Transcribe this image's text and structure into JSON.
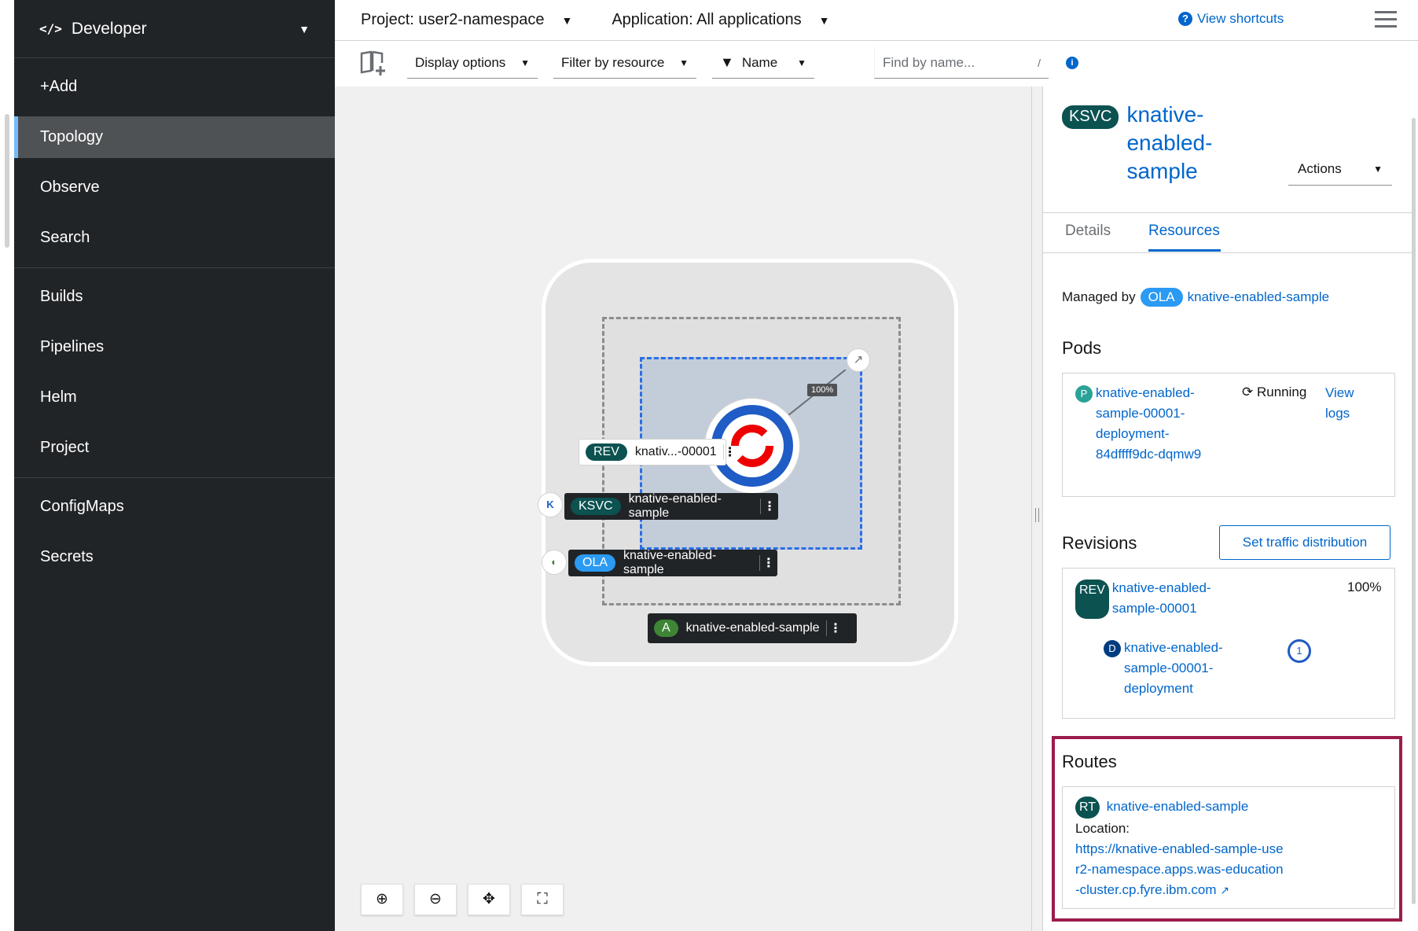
{
  "perspective": {
    "icon": "code-icon",
    "label": "Developer"
  },
  "nav": {
    "groups": [
      [
        {
          "label": "+Add"
        },
        {
          "label": "Topology",
          "active": true
        },
        {
          "label": "Observe"
        },
        {
          "label": "Search"
        }
      ],
      [
        {
          "label": "Builds"
        },
        {
          "label": "Pipelines"
        },
        {
          "label": "Helm"
        },
        {
          "label": "Project"
        }
      ],
      [
        {
          "label": "ConfigMaps"
        },
        {
          "label": "Secrets"
        }
      ]
    ]
  },
  "topbar": {
    "project": "Project: user2-namespace",
    "application": "Application: All applications",
    "shortcuts": "View shortcuts"
  },
  "toolbar": {
    "display_options": "Display options",
    "filter_by_resource": "Filter by resource",
    "filter_field": "Name",
    "find_placeholder": "Find by name...",
    "find_shortcut": "/"
  },
  "topology": {
    "traffic_percent": "100%",
    "revision": {
      "badge": "REV",
      "label": "knativ...-00001"
    },
    "service": {
      "badge": "KSVC",
      "label": "knative-enabled-sample"
    },
    "operator_app": {
      "badge": "OLA",
      "label": "knative-enabled-sample"
    },
    "application": {
      "badge": "A",
      "label": "knative-enabled-sample"
    }
  },
  "panel": {
    "kind_badge": "KSVC",
    "title": "knative-enabled-sample",
    "actions": "Actions",
    "tabs": {
      "details": "Details",
      "resources": "Resources"
    },
    "managed_by": {
      "label": "Managed by",
      "badge": "OLA",
      "name": "knative-enabled-sample"
    },
    "pods": {
      "heading": "Pods",
      "badge": "P",
      "name": "knative-enabled-sample-00001-deployment-84dffff9dc-dqmw9",
      "status": "Running",
      "logs": "View logs"
    },
    "revisions": {
      "heading": "Revisions",
      "set_traffic": "Set traffic distribution",
      "rev_badge": "REV",
      "rev_name": "knative-enabled-sample-00001",
      "percent": "100%",
      "deploy_badge": "D",
      "deploy_name": "knative-enabled-sample-00001-deployment",
      "pod_count": "1"
    },
    "routes": {
      "heading": "Routes",
      "badge": "RT",
      "name": "knative-enabled-sample",
      "location_label": "Location:",
      "url": "https://knative-enabled-sample-user2-namespace.apps.was-education-cluster.cp.fyre.ibm.com"
    }
  },
  "colors": {
    "sidebar_bg": "#212427",
    "link": "#0066cc",
    "highlight_border": "#9b1c4c",
    "rev_badge": "#0b5251",
    "ola_badge": "#2b9af3",
    "app_badge": "#3e8635"
  }
}
